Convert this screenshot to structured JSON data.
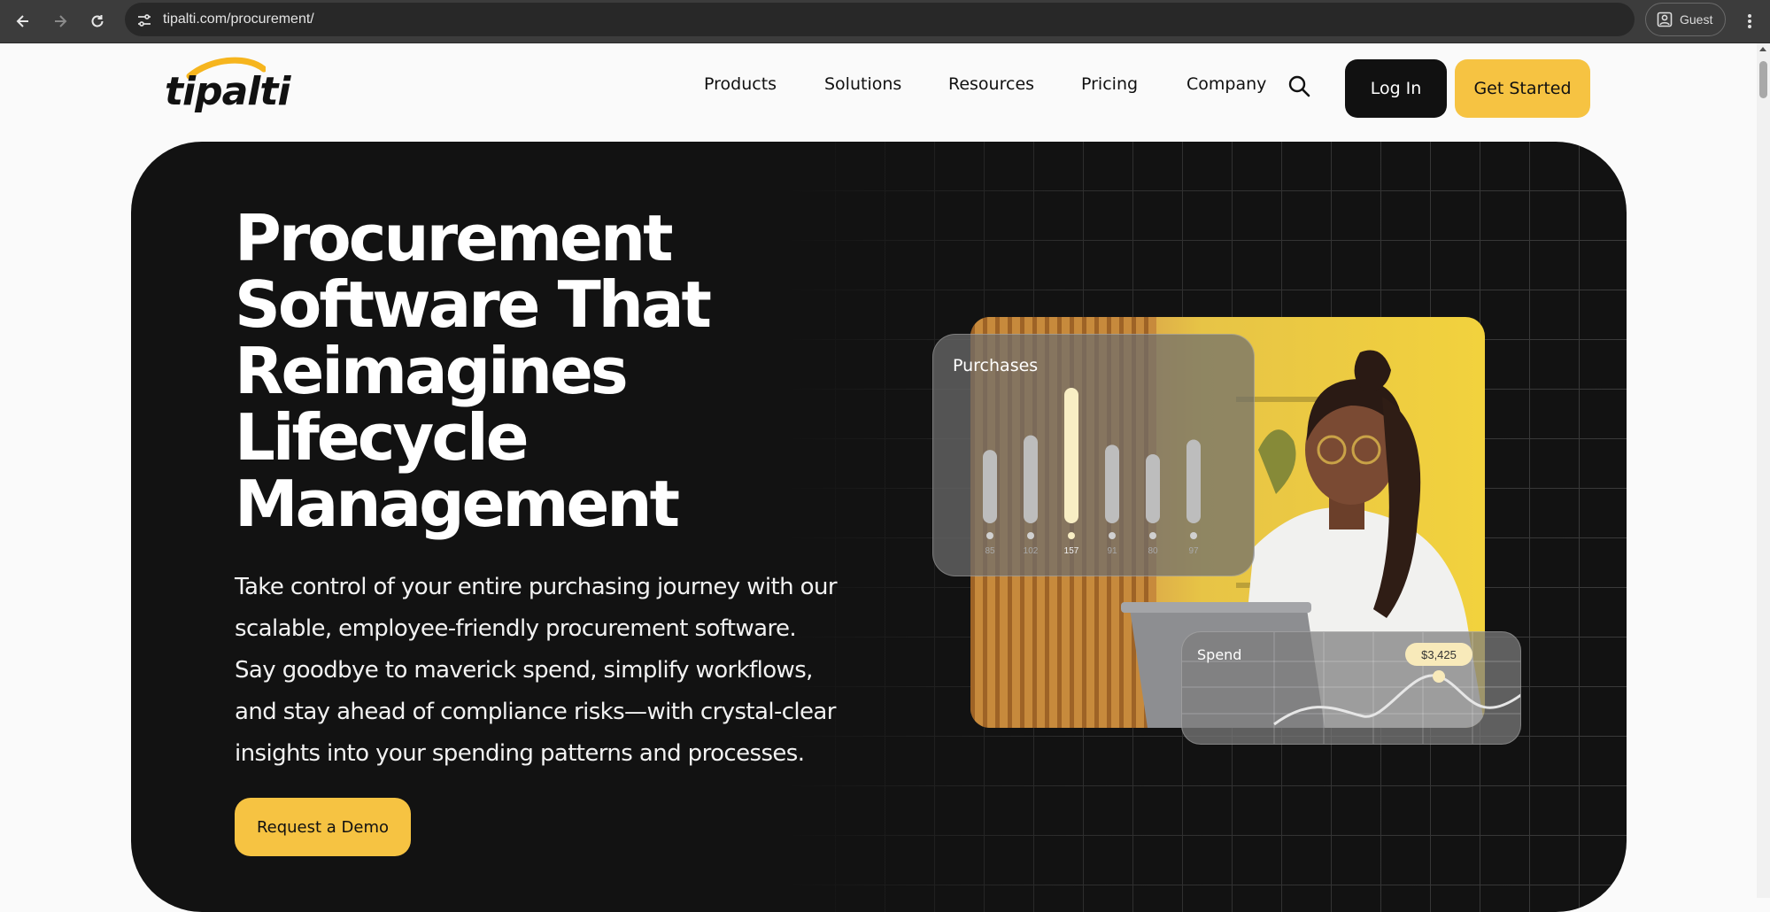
{
  "browser": {
    "url": "tipalti.com/procurement/",
    "profile_label": "Guest"
  },
  "site": {
    "logo_text": "tipalti",
    "nav": [
      "Products",
      "Solutions",
      "Resources",
      "Pricing",
      "Company"
    ],
    "login_label": "Log In",
    "cta_label": "Get Started"
  },
  "hero": {
    "title_lines": [
      "Procurement",
      "Software That",
      "Reimagines",
      "Lifecycle",
      "Management"
    ],
    "description_lines": [
      "Take control of your entire purchasing journey with our",
      "scalable, employee-friendly procurement software.",
      "Say goodbye to maverick spend, simplify workflows,",
      "and stay ahead of compliance risks—with crystal-clear",
      "insights into your spending patterns and processes."
    ],
    "demo_label": "Request a Demo"
  },
  "purchases_widget": {
    "title": "Purchases",
    "values": [
      85,
      102,
      157,
      91,
      80,
      97
    ],
    "highlight_index": 2
  },
  "spend_widget": {
    "title": "Spend",
    "badge": "$3,425"
  },
  "colors": {
    "accent": "#f6c342",
    "hero_bg": "#121212"
  }
}
